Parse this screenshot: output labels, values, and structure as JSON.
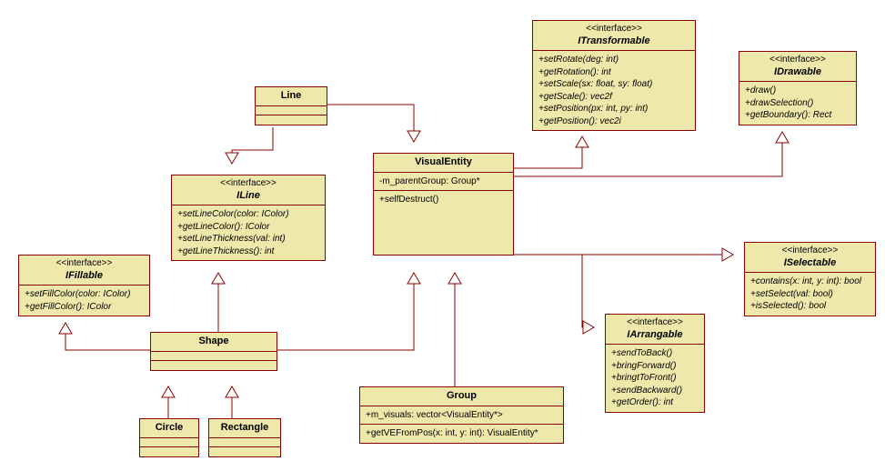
{
  "stereotype": "<<interface>>",
  "classes": {
    "ITransformable": {
      "name": "ITransformable",
      "ops": [
        "+setRotate(deg: int)",
        "+getRotation(): int",
        "+setScale(sx: float, sy: float)",
        "+getScale(): vec2f",
        "+setPosition(px: int, py: int)",
        "+getPosition(): vec2i"
      ]
    },
    "IDrawable": {
      "name": "IDrawable",
      "ops": [
        "+draw()",
        "+drawSelection()",
        "+getBoundary(): Rect"
      ]
    },
    "ISelectable": {
      "name": "ISelectable",
      "ops": [
        "+contains(x: int, y: int): bool",
        "+setSelect(val: bool)",
        "+isSelected(): bool"
      ]
    },
    "IArrangable": {
      "name": "IArrangable",
      "ops": [
        "+sendToBack()",
        "+bringForward()",
        "+bringtToFront()",
        "+sendBackward()",
        "+getOrder(): int"
      ]
    },
    "ILine": {
      "name": "ILine",
      "ops": [
        "+setLineColor(color: IColor)",
        "+getLineColor(): IColor",
        "+setLineThickness(val: int)",
        "+getLineThickness(): int"
      ]
    },
    "IFillable": {
      "name": "IFillable",
      "ops": [
        "+setFillColor(color: IColor)",
        "+getFillColor(): IColor"
      ]
    },
    "VisualEntity": {
      "name": "VisualEntity",
      "attrs": [
        "-m_parentGroup: Group*"
      ],
      "ops": [
        "+selfDestruct()"
      ]
    },
    "Group": {
      "name": "Group",
      "attrs": [
        "+m_visuals: vector<VisualEntity*>"
      ],
      "ops": [
        "+getVEFromPos(x: int, y: int): VisualEntity*"
      ]
    },
    "Line": {
      "name": "Line"
    },
    "Shape": {
      "name": "Shape"
    },
    "Circle": {
      "name": "Circle"
    },
    "Rectangle": {
      "name": "Rectangle"
    }
  }
}
